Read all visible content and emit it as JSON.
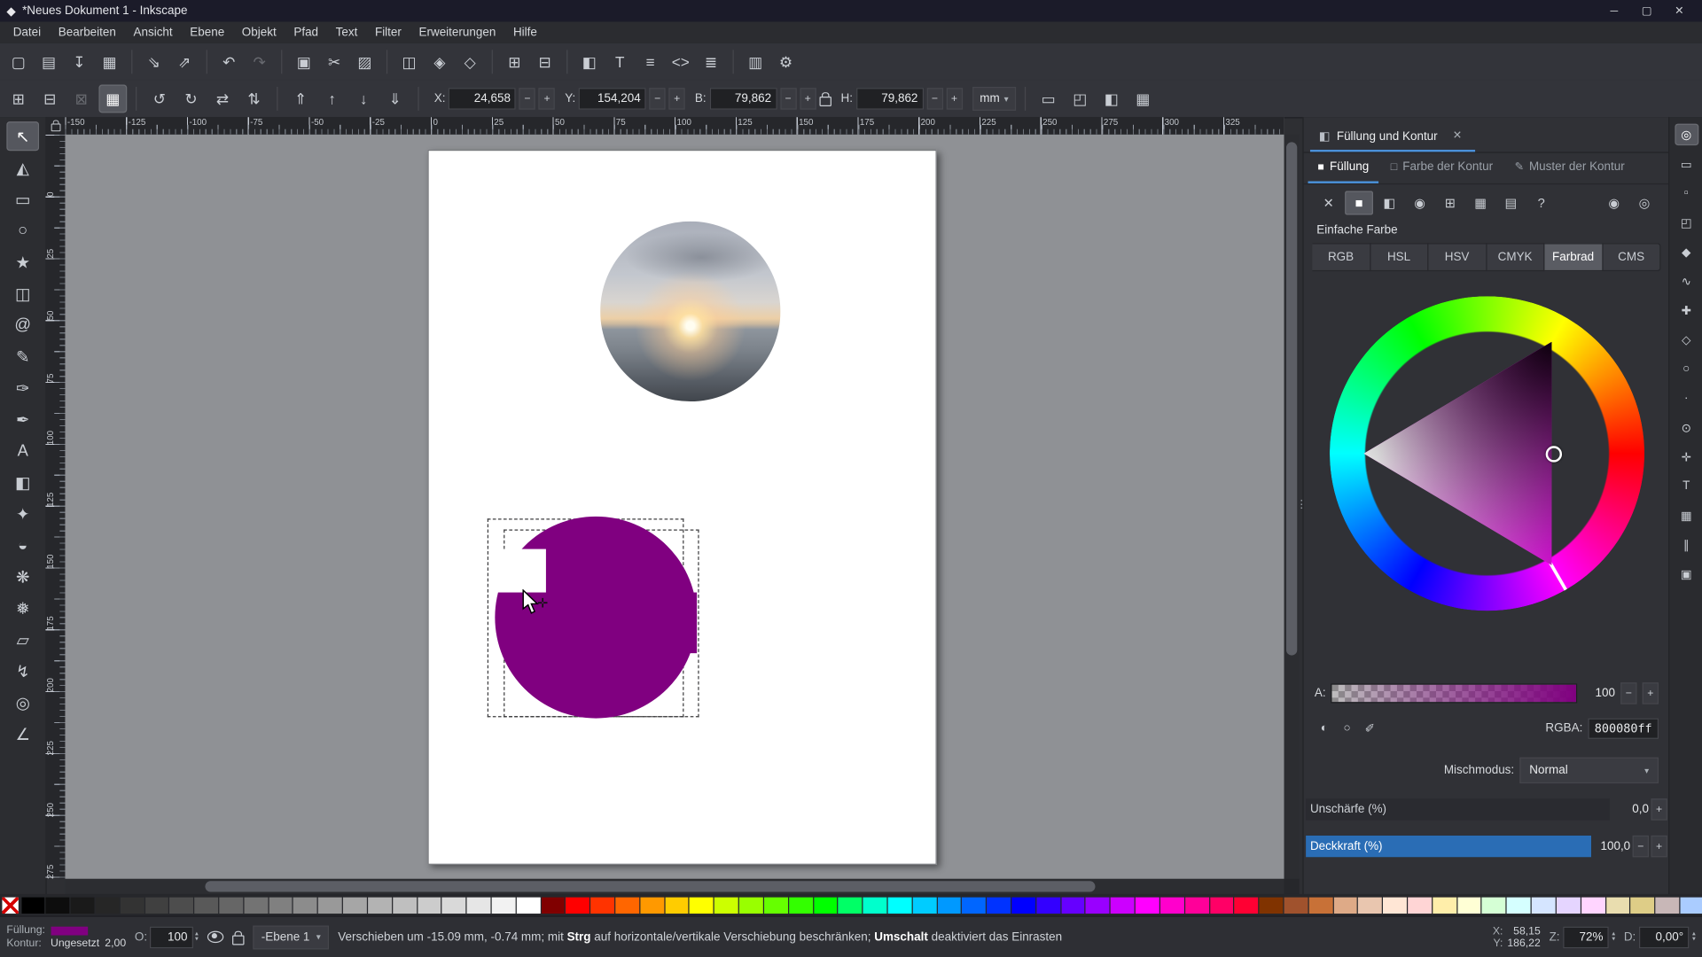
{
  "window": {
    "title": "*Neues Dokument 1 - Inkscape",
    "icon": "◆",
    "controls": [
      {
        "name": "minimize-button",
        "glyph": "─"
      },
      {
        "name": "maximize-button",
        "glyph": "▢"
      },
      {
        "name": "close-button",
        "glyph": "✕"
      }
    ]
  },
  "menu": {
    "items": [
      {
        "name": "menu-datei",
        "label": "Datei"
      },
      {
        "name": "menu-bearbeiten",
        "label": "Bearbeiten"
      },
      {
        "name": "menu-ansicht",
        "label": "Ansicht"
      },
      {
        "name": "menu-ebene",
        "label": "Ebene"
      },
      {
        "name": "menu-objekt",
        "label": "Objekt"
      },
      {
        "name": "menu-pfad",
        "label": "Pfad"
      },
      {
        "name": "menu-text",
        "label": "Text"
      },
      {
        "name": "menu-filter",
        "label": "Filter"
      },
      {
        "name": "menu-erweiterungen",
        "label": "Erweiterungen"
      },
      {
        "name": "menu-hilfe",
        "label": "Hilfe"
      }
    ]
  },
  "command_toolbar": [
    {
      "name": "new-document",
      "glyph": "▢"
    },
    {
      "name": "open-document",
      "glyph": "▤"
    },
    {
      "name": "save-document",
      "glyph": "↧"
    },
    {
      "name": "print",
      "glyph": "▦"
    },
    {
      "name": "separator",
      "glyph": "",
      "cls": "sep"
    },
    {
      "name": "import",
      "glyph": "⇘"
    },
    {
      "name": "export",
      "glyph": "⇗"
    },
    {
      "name": "separator",
      "glyph": "",
      "cls": "sep"
    },
    {
      "name": "undo",
      "glyph": "↶"
    },
    {
      "name": "redo",
      "glyph": "↷",
      "cls": "disabled"
    },
    {
      "name": "separator",
      "glyph": "",
      "cls": "sep"
    },
    {
      "name": "copy",
      "glyph": "▣"
    },
    {
      "name": "cut",
      "glyph": "✂"
    },
    {
      "name": "paste",
      "glyph": "▨"
    },
    {
      "name": "separator",
      "glyph": "",
      "cls": "sep"
    },
    {
      "name": "duplicate",
      "glyph": "◫"
    },
    {
      "name": "clone",
      "glyph": "◈"
    },
    {
      "name": "unlink-clone",
      "glyph": "◇"
    },
    {
      "name": "separator",
      "glyph": "",
      "cls": "sep"
    },
    {
      "name": "group",
      "glyph": "⊞"
    },
    {
      "name": "ungroup",
      "glyph": "⊟"
    },
    {
      "name": "separator",
      "glyph": "",
      "cls": "sep"
    },
    {
      "name": "fill-stroke-dialog",
      "glyph": "◧"
    },
    {
      "name": "text-dialog",
      "glyph": "T"
    },
    {
      "name": "align-distribute-dialog",
      "glyph": "≡"
    },
    {
      "name": "xml-editor",
      "glyph": "<>"
    },
    {
      "name": "layers-dialog",
      "glyph": "≣"
    },
    {
      "name": "separator",
      "glyph": "",
      "cls": "sep"
    },
    {
      "name": "document-properties",
      "glyph": "▥"
    },
    {
      "name": "preferences",
      "glyph": "⚙"
    }
  ],
  "tool_controls": {
    "left": [
      {
        "name": "select-all",
        "glyph": "⊞"
      },
      {
        "name": "select-all-layers",
        "glyph": "⊟"
      },
      {
        "name": "deselect",
        "glyph": "⊠",
        "cls": "disabled"
      },
      {
        "name": "selection-touch-toggle",
        "glyph": "▦",
        "cls": "active"
      },
      {
        "name": "separator",
        "glyph": "",
        "cls": "sep"
      },
      {
        "name": "rotate-90-ccw",
        "glyph": "↺"
      },
      {
        "name": "rotate-90-cw",
        "glyph": "↻"
      },
      {
        "name": "flip-horizontal",
        "glyph": "⇄"
      },
      {
        "name": "flip-vertical",
        "glyph": "⇅"
      },
      {
        "name": "separator",
        "glyph": "",
        "cls": "sep"
      },
      {
        "name": "raise-to-top",
        "glyph": "⇑"
      },
      {
        "name": "raise",
        "glyph": "↑"
      },
      {
        "name": "lower",
        "glyph": "↓"
      },
      {
        "name": "lower-to-bottom",
        "glyph": "⇓"
      },
      {
        "name": "separator",
        "glyph": "",
        "cls": "sep"
      }
    ],
    "x_label": "X:",
    "x": "24,658",
    "y_label": "Y:",
    "y": "154,204",
    "w_label": "B:",
    "w": "79,862",
    "h_label": "H:",
    "h": "79,862",
    "minus": "−",
    "plus": "+",
    "unit": "mm",
    "caret": "▾",
    "toggles": [
      {
        "name": "scale-stroke-toggle",
        "glyph": "▭"
      },
      {
        "name": "move-corners-toggle",
        "glyph": "◰"
      },
      {
        "name": "move-gradients-toggle",
        "glyph": "◧"
      },
      {
        "name": "move-patterns-toggle",
        "glyph": "▦"
      }
    ]
  },
  "toolbox": [
    {
      "name": "selector-tool",
      "glyph": "↖",
      "cls": "active"
    },
    {
      "name": "node-tool",
      "glyph": "◭"
    },
    {
      "name": "rectangle-tool",
      "glyph": "▭"
    },
    {
      "name": "ellipse-tool",
      "glyph": "○"
    },
    {
      "name": "star-tool",
      "glyph": "★"
    },
    {
      "name": "box3d-tool",
      "glyph": "◫"
    },
    {
      "name": "spiral-tool",
      "glyph": "@"
    },
    {
      "name": "pencil-tool",
      "glyph": "✎"
    },
    {
      "name": "pen-tool",
      "glyph": "✑"
    },
    {
      "name": "calligraphy-tool",
      "glyph": "✒"
    },
    {
      "name": "text-tool",
      "glyph": "A"
    },
    {
      "name": "gradient-tool",
      "glyph": "◧"
    },
    {
      "name": "dropper-tool",
      "glyph": "✦"
    },
    {
      "name": "paint-bucket-tool",
      "glyph": "◒"
    },
    {
      "name": "tweak-tool",
      "glyph": "❋"
    },
    {
      "name": "spray-tool",
      "glyph": "❅"
    },
    {
      "name": "eraser-tool",
      "glyph": "▱"
    },
    {
      "name": "connector-tool",
      "glyph": "↯"
    },
    {
      "name": "zoom-tool",
      "glyph": "◎"
    },
    {
      "name": "measure-tool",
      "glyph": "∠"
    }
  ],
  "ruler": {
    "h_labels": [
      "-150",
      "-125",
      "-100",
      "-75",
      "-50",
      "-25",
      "0",
      "25",
      "50",
      "75",
      "100",
      "125",
      "150",
      "175",
      "200",
      "225",
      "250",
      "275",
      "300",
      "325"
    ],
    "v_labels": [
      "0",
      "25",
      "50",
      "75",
      "100",
      "125",
      "150",
      "175",
      "200",
      "225",
      "250",
      "275"
    ]
  },
  "canvas": {
    "object_color": "#800080"
  },
  "dock": {
    "title": "Füllung und Kontur",
    "title_icon": "◧",
    "close_glyph": "✕",
    "tabs": [
      {
        "name": "tab-fuellung",
        "icon": "■",
        "label": "Füllung",
        "cls": "active"
      },
      {
        "name": "tab-farbe-der-kontur",
        "icon": "□",
        "label": "Farbe der Kontur"
      },
      {
        "name": "tab-muster-der-kontur",
        "icon": "✎",
        "label": "Muster der Kontur"
      }
    ],
    "fill_types": [
      {
        "name": "fill-none",
        "glyph": "✕"
      },
      {
        "name": "fill-flat",
        "glyph": "■",
        "cls": "active"
      },
      {
        "name": "fill-linear-gradient",
        "glyph": "◧"
      },
      {
        "name": "fill-radial-gradient",
        "glyph": "◉"
      },
      {
        "name": "fill-mesh-gradient",
        "glyph": "⊞"
      },
      {
        "name": "fill-pattern",
        "glyph": "▦"
      },
      {
        "name": "fill-swatch",
        "glyph": "▤"
      },
      {
        "name": "fill-unknown",
        "glyph": "?"
      }
    ],
    "fill_rules": [
      {
        "name": "fill-rule-nonzero",
        "glyph": "◉"
      },
      {
        "name": "fill-rule-evenodd",
        "glyph": "◎"
      }
    ],
    "section_label": "Einfache Farbe",
    "modes": [
      {
        "name": "mode-rgb",
        "label": "RGB"
      },
      {
        "name": "mode-hsl",
        "label": "HSL"
      },
      {
        "name": "mode-hsv",
        "label": "HSV"
      },
      {
        "name": "mode-cmyk",
        "label": "CMYK"
      },
      {
        "name": "mode-farbrad",
        "label": "Farbrad",
        "cls": "active"
      },
      {
        "name": "mode-cms",
        "label": "CMS"
      }
    ],
    "alpha": {
      "label": "A:",
      "value": "100"
    },
    "rgba_icons": [
      {
        "name": "gamut-icon",
        "glyph": "◐"
      },
      {
        "name": "color-warning-icon",
        "glyph": "○"
      },
      {
        "name": "pick-color-button",
        "glyph": "✐"
      }
    ],
    "rgba": {
      "label": "RGBA:",
      "value": "800080ff"
    },
    "blend": {
      "label": "Mischmodus:",
      "value": "Normal"
    },
    "blur": {
      "label": "Unschärfe (%)",
      "value": "0,0"
    },
    "opacity": {
      "label": "Deckkraft (%)",
      "value": "100,0"
    },
    "minus": "−",
    "plus": "+",
    "caret": "▾",
    "fill_color": "#800080",
    "accent": "#4a90d9",
    "opacity_bar_color": "#2a6db5"
  },
  "snapbar": [
    {
      "name": "snap-toggle",
      "glyph": "◎",
      "cls": "active"
    },
    {
      "name": "snap-bbox",
      "glyph": "▭"
    },
    {
      "name": "snap-bbox-edges",
      "glyph": "▫"
    },
    {
      "name": "snap-bbox-corners",
      "glyph": "◰"
    },
    {
      "name": "snap-nodes",
      "glyph": "◆"
    },
    {
      "name": "snap-paths",
      "glyph": "∿"
    },
    {
      "name": "snap-path-intersections",
      "glyph": "✚"
    },
    {
      "name": "snap-cusp-nodes",
      "glyph": "◇"
    },
    {
      "name": "snap-smooth-nodes",
      "glyph": "○"
    },
    {
      "name": "snap-midpoints",
      "glyph": "∙"
    },
    {
      "name": "snap-object-centers",
      "glyph": "⊙"
    },
    {
      "name": "snap-rotation-centers",
      "glyph": "✛"
    },
    {
      "name": "snap-text-baseline",
      "glyph": "T"
    },
    {
      "name": "snap-grid",
      "glyph": "▦"
    },
    {
      "name": "snap-guides",
      "glyph": "∥"
    },
    {
      "name": "snap-page-border",
      "glyph": "▣"
    }
  ],
  "palette": [
    "#000000",
    "#0d0d0d",
    "#1a1a1a",
    "#262626",
    "#333333",
    "#404040",
    "#4d4d4d",
    "#595959",
    "#666666",
    "#737373",
    "#808080",
    "#8c8c8c",
    "#999999",
    "#a6a6a6",
    "#b3b3b3",
    "#bfbfbf",
    "#cccccc",
    "#d9d9d9",
    "#e6e6e6",
    "#f2f2f2",
    "#ffffff",
    "#800000",
    "#ff0000",
    "#ff3300",
    "#ff6600",
    "#ff9900",
    "#ffcc00",
    "#ffff00",
    "#ccff00",
    "#99ff00",
    "#66ff00",
    "#33ff00",
    "#00ff00",
    "#00ff66",
    "#00ffcc",
    "#00ffff",
    "#00ccff",
    "#0099ff",
    "#0066ff",
    "#0033ff",
    "#0000ff",
    "#3300ff",
    "#6600ff",
    "#9900ff",
    "#cc00ff",
    "#ff00ff",
    "#ff00cc",
    "#ff0099",
    "#ff0066",
    "#ff0033",
    "#803300",
    "#a0522d",
    "#c87137",
    "#deaa87",
    "#e9c6af",
    "#ffe6d5",
    "#ffd5d5",
    "#ffeeaa",
    "#ffffd5",
    "#d5ffd5",
    "#d5ffff",
    "#d5e5ff",
    "#e5d5ff",
    "#ffd5ff",
    "#e9ddaf",
    "#decd87",
    "#c8b7b7",
    "#aaccff"
  ],
  "statusbar": {
    "fill_label": "Füllung:",
    "fill_css": "background:#800080",
    "stroke_label": "Kontur:",
    "stroke_value": "Ungesetzt",
    "stroke_width": "2,00",
    "opacity_label": "O:",
    "opacity_value": "100",
    "layer_label": "-Ebene 1",
    "layer_caret": "▾",
    "message": {
      "pre": "Verschieben um -15.09 mm, -0.74 mm; mit ",
      "key1": "Strg",
      "mid": " auf horizontale/vertikale Verschiebung beschränken; ",
      "key2": "Umschalt",
      "post": " deaktiviert das Einrasten"
    },
    "x_label": "X:",
    "x_value": "58,15",
    "y_label": "Y:",
    "y_value": "186,22",
    "zoom_label": "Z:",
    "zoom_value": "72%",
    "rotation_label": "D:",
    "rotation_value": "0,00°"
  }
}
